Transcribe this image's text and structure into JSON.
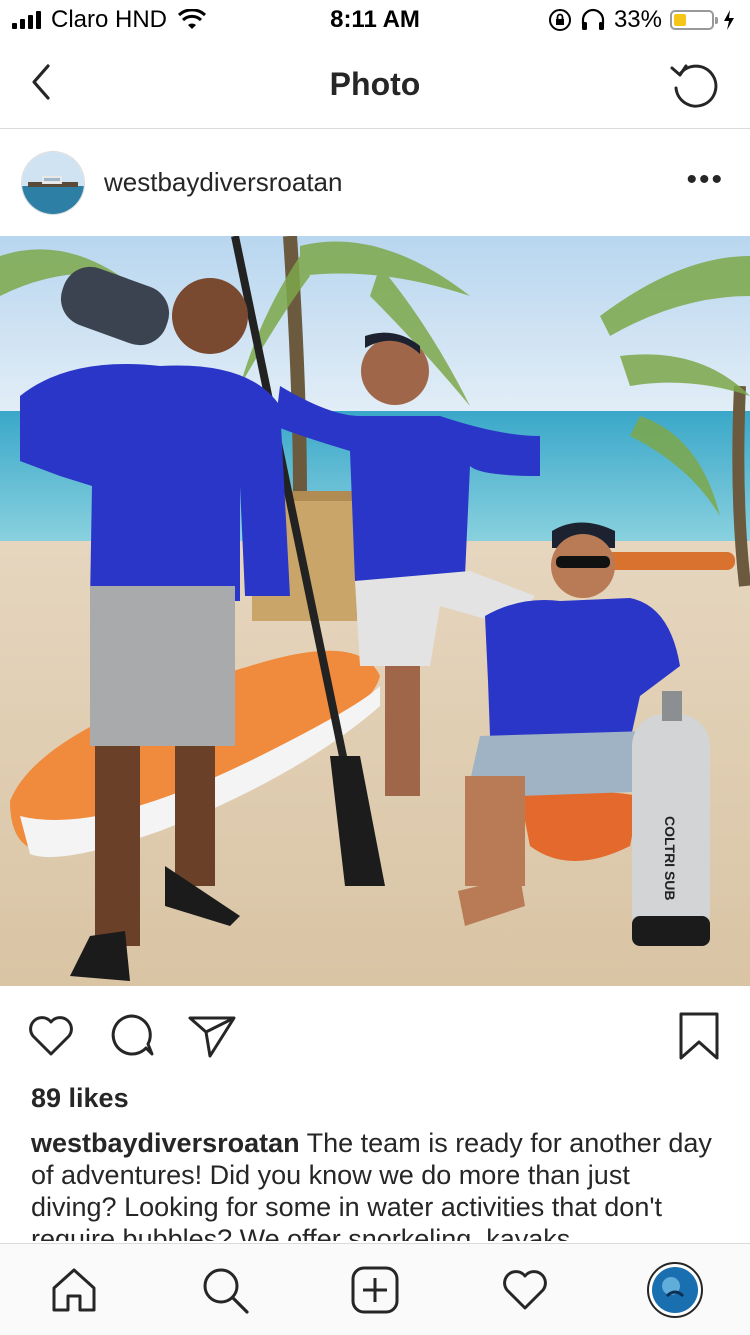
{
  "status_bar": {
    "carrier": "Claro HND",
    "time": "8:11 AM",
    "battery": "33%",
    "battery_level": 0.33
  },
  "nav": {
    "title": "Photo",
    "back_icon": "chevron-left-icon",
    "refresh_icon": "refresh-icon"
  },
  "post": {
    "username": "westbaydiversroatan",
    "more_icon": "more-dots-icon",
    "likes": "89 likes",
    "caption_user": "westbaydiversroatan",
    "caption_text": "The team is ready for another day of adventures! Did you know we do more than just diving? Looking for some in water activities that don't require bubbles? We offer snorkeling, kayaks"
  },
  "actions": {
    "like_icon": "heart-icon",
    "comment_icon": "comment-icon",
    "share_icon": "send-icon",
    "save_icon": "bookmark-icon"
  },
  "tabbar": {
    "items": [
      "home-icon",
      "search-icon",
      "add-icon",
      "activity-heart-icon",
      "profile-avatar"
    ]
  },
  "colors": {
    "text": "#262626",
    "divider": "#dbdbdb",
    "battery": "#f5c518"
  }
}
